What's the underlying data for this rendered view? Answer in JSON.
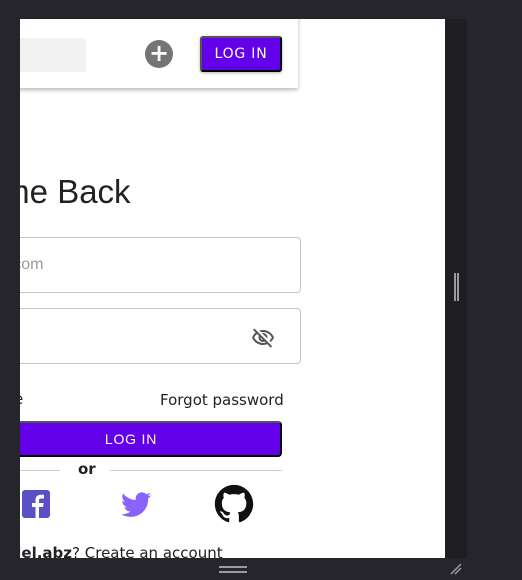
{
  "topbar": {
    "search_placeholder": "",
    "add_symbol": "+",
    "login_label": "LOG IN"
  },
  "form": {
    "title": "lcome Back",
    "email_value": "abz.com",
    "password_value": "",
    "remember_label": "e",
    "forgot_label": "Forgot password",
    "login_label": "LOG IN",
    "or_label": "or"
  },
  "footer": {
    "username": "ndel.abz",
    "question": "? Create an account"
  },
  "colors": {
    "primary": "#6200ea",
    "twitter": "#8a63ff",
    "facebook": "#5a4fc4"
  },
  "icons": {
    "add": "plus-circle-icon",
    "eye": "eye-off-icon",
    "facebook": "facebook-icon",
    "twitter": "twitter-icon",
    "github": "github-icon"
  }
}
